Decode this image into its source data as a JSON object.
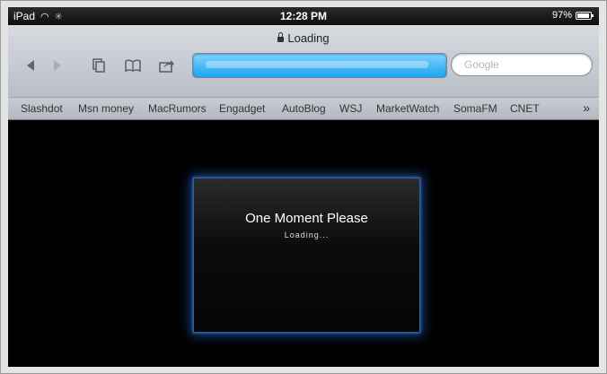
{
  "status_bar": {
    "device": "iPad",
    "time": "12:28 PM",
    "battery": "97%"
  },
  "toolbar": {
    "page_title": "Loading",
    "search_placeholder": "Google"
  },
  "bookmarks": [
    "Slashdot",
    "Msn money",
    "MacRumors",
    "Engadget",
    "AutoBlog",
    "WSJ",
    "MarketWatch",
    "SomaFM",
    "CNET"
  ],
  "bookmarks_more": "»",
  "content": {
    "title": "One Moment Please",
    "subtitle": "Loading..."
  },
  "colors": {
    "address_bar": "#1fa3ee",
    "loading_glow": "#2c6fd6"
  }
}
